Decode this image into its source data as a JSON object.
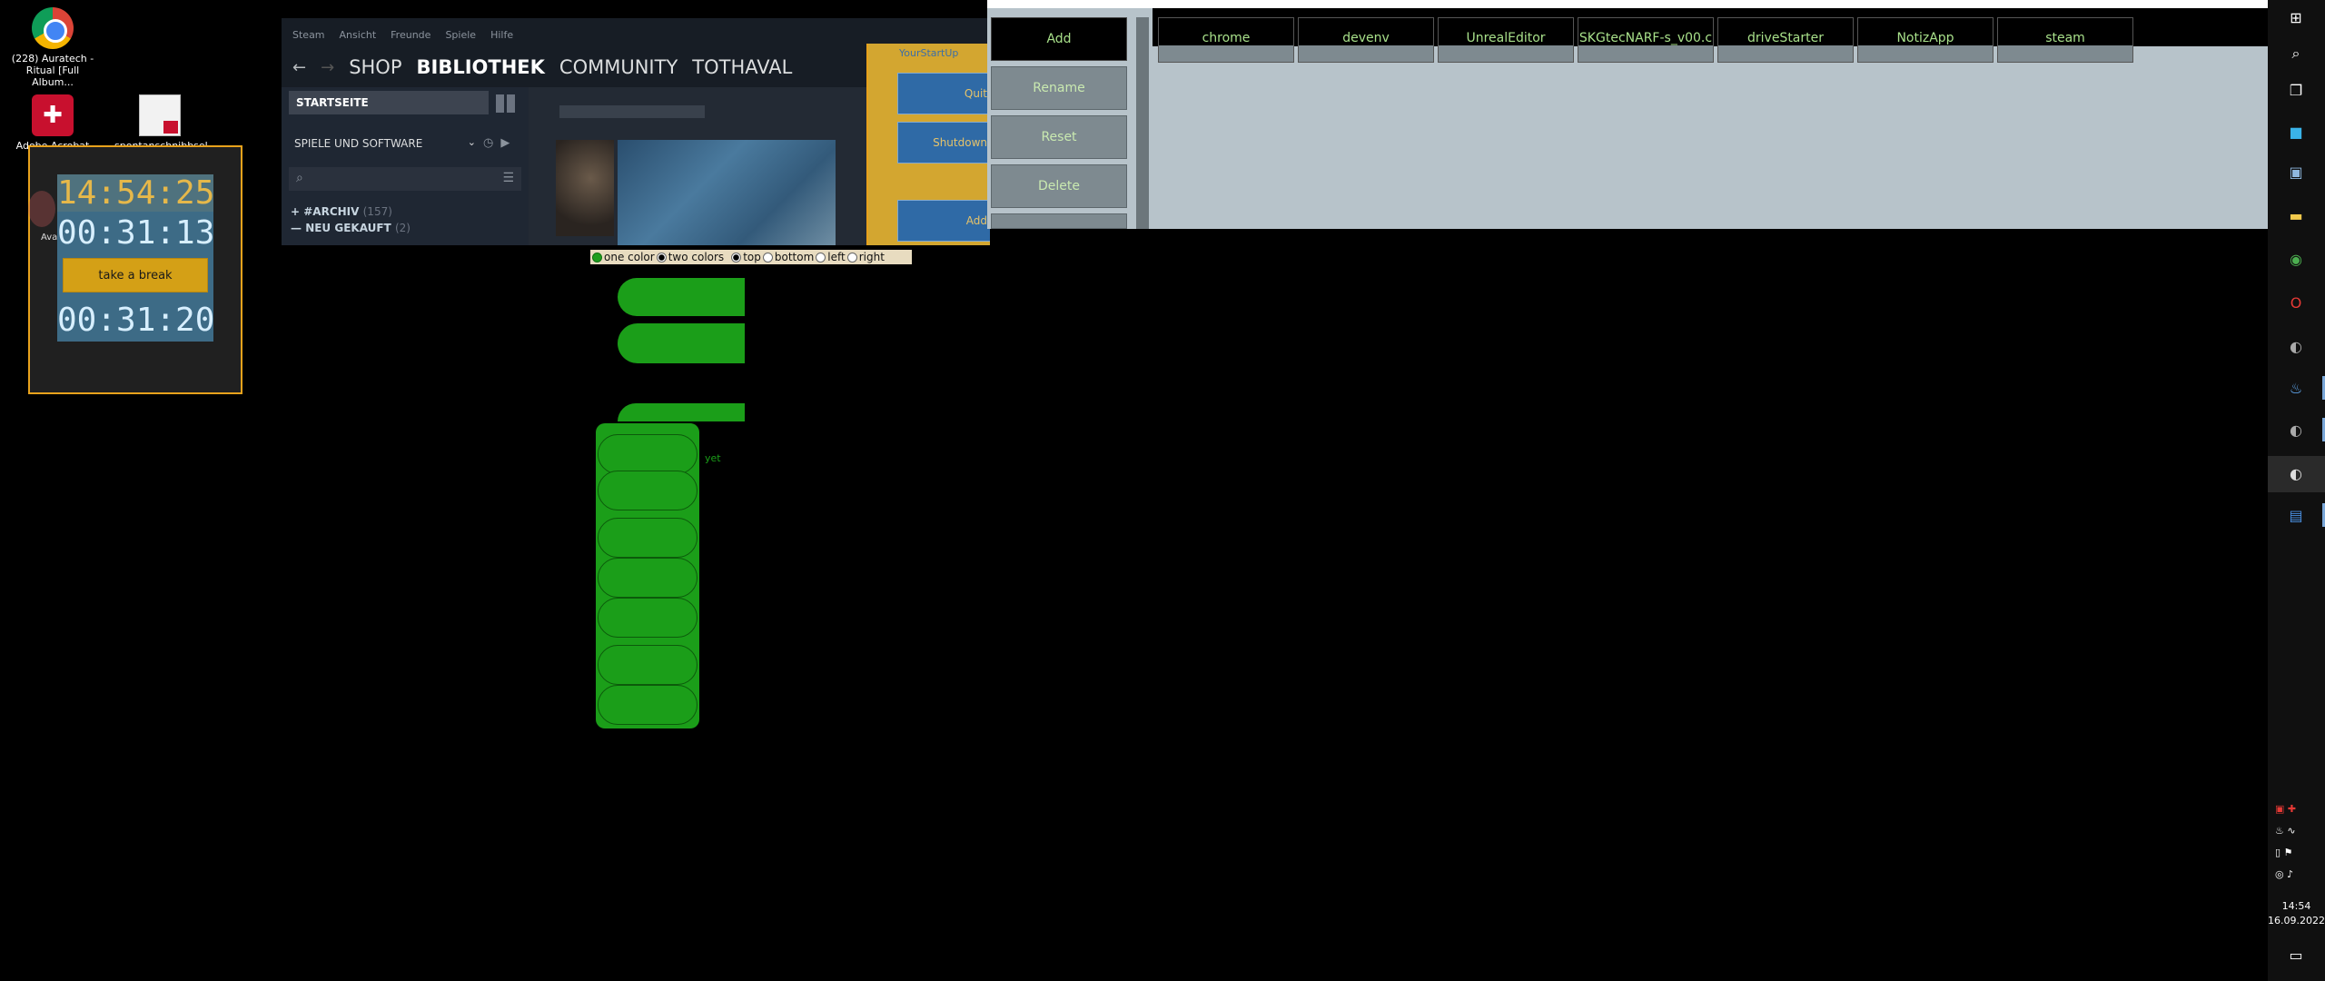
{
  "desktop": {
    "icons": [
      {
        "label": "(228) Auratech - Ritual [Full Album..."
      },
      {
        "label": "Adobe Acrobat DC"
      },
      {
        "label": "spontanschnibbsel..."
      },
      {
        "label": "Ava"
      }
    ]
  },
  "timer": {
    "clock": "14:54:25",
    "elapsed": "00:31:13",
    "break_label": "take a break",
    "total": "00:31:20"
  },
  "steam": {
    "menu": [
      "Steam",
      "Ansicht",
      "Freunde",
      "Spiele",
      "Hilfe"
    ],
    "nav": [
      "SHOP",
      "BIBLIOTHEK",
      "COMMUNITY",
      "TOTHAVAL"
    ],
    "startseite": "STARTSEITE",
    "filter": "SPIELE UND SOFTWARE",
    "rows": [
      {
        "prefix": "+",
        "label": "#ARCHIV",
        "count": "(157)"
      },
      {
        "prefix": "—",
        "label": "NEU GEKAUFT",
        "count": "(2)"
      }
    ]
  },
  "yourstartup": {
    "title": "YourStartUp",
    "buttons": [
      "Quit",
      "Shutdown",
      "Add"
    ]
  },
  "launcher": {
    "actions": [
      "Add",
      "Rename",
      "Reset",
      "Delete"
    ],
    "apps": [
      "chrome",
      "devenv",
      "UnrealEditor",
      "SKGtecNARF-s_v00.c",
      "driveStarter",
      "NotizApp",
      "steam"
    ]
  },
  "options": {
    "items": [
      "one color",
      "two colors",
      "top",
      "bottom",
      "left",
      "right"
    ]
  },
  "green_panel": {
    "note": "yet"
  },
  "taskbar": {
    "time": "14:54",
    "date": "16.09.2022"
  },
  "colors": {
    "accent_orange": "#e8a21c",
    "green": "#1b9e19",
    "timer_bg": "#3d6b86",
    "launcher_bg": "#b7c3ca"
  }
}
